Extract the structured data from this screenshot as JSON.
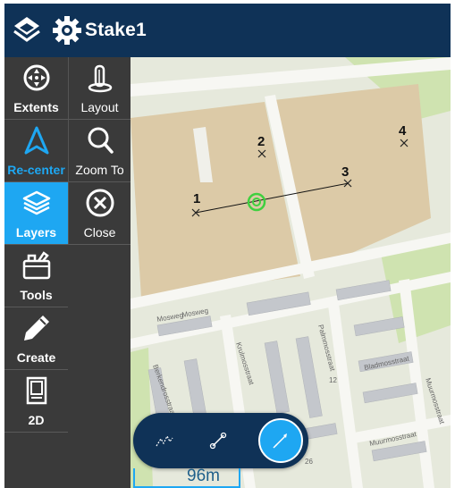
{
  "header": {
    "title": "Stake1"
  },
  "sidebar": {
    "left": [
      {
        "label": "Extents",
        "icon": "extents-icon"
      },
      {
        "label": "Re-center",
        "icon": "navigation-arrow-icon"
      },
      {
        "label": "Layers",
        "icon": "layers-icon"
      },
      {
        "label": "Tools",
        "icon": "toolbox-icon"
      },
      {
        "label": "Create",
        "icon": "pencil-icon"
      },
      {
        "label": "2D",
        "icon": "map-2d-icon"
      }
    ],
    "right": [
      {
        "label": "Layout",
        "icon": "layout-icon"
      },
      {
        "label": "Zoom To",
        "icon": "zoom-search-icon"
      },
      {
        "label": "Close",
        "icon": "close-circle-icon"
      }
    ]
  },
  "map": {
    "points": [
      "1",
      "2",
      "3",
      "4"
    ],
    "streets": [
      "Mosweg",
      "Mosweg",
      "Berkendrosstraat",
      "Palmmosstraat",
      "Krulmosstraat",
      "Bladmosstraat",
      "Muurmosstraat",
      "Muurmosstraat"
    ],
    "house_numbers": [
      "12",
      "26"
    ]
  },
  "toolbar": {
    "buttons": [
      "polyline-icon",
      "line-icon",
      "draw-line-icon"
    ]
  },
  "scale": {
    "label": "96m"
  },
  "colors": {
    "header": "#0f3257",
    "accent": "#1ea7f2",
    "sidebar": "#3a3a3a"
  }
}
